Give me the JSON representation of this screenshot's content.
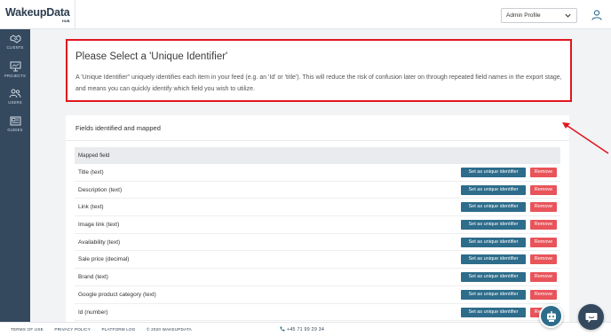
{
  "header": {
    "logo_main": "WakeupData",
    "logo_sub": "HUB",
    "profile_select": "Admin Profile"
  },
  "sidebar": {
    "items": [
      {
        "label": "CLIENTS",
        "icon": "handshake-icon"
      },
      {
        "label": "PROJECTS",
        "icon": "presentation-board-icon"
      },
      {
        "label": "USERS",
        "icon": "users-icon"
      },
      {
        "label": "GUIDES",
        "icon": "newspaper-icon"
      }
    ]
  },
  "callout": {
    "title": "Please Select a 'Unique Identifier'",
    "text": "A 'Unique Identifier\" uniquely identifies each item in your feed (e.g. an 'Id' or 'title'). This will reduce the risk of confusion later on through repeated field names in the export stage, and means you can quickly identify which field you wish to utilize."
  },
  "panel": {
    "title": "Fields identified and mapped",
    "column_header": "Mapped field",
    "set_label": "Set as unique identifier",
    "remove_label": "Remove",
    "rows": [
      "Title (text)",
      "Description (text)",
      "Link (text)",
      "Image link (text)",
      "Availability (text)",
      "Sale price (decimal)",
      "Brand (text)",
      "Google product category (text)",
      "Id (number)"
    ]
  },
  "footer": {
    "links": [
      "TERMS OF USE",
      "PRIVACY POLICY",
      "PLATFORM LOG",
      "© 2020 WAKEUPDATA"
    ],
    "phone": "+45 71 99 29 34"
  },
  "colors": {
    "sidebar": "#34495e",
    "primary_button": "#2d6c8b",
    "remove_button": "#e8545a",
    "highlight_border": "#e0161e"
  }
}
